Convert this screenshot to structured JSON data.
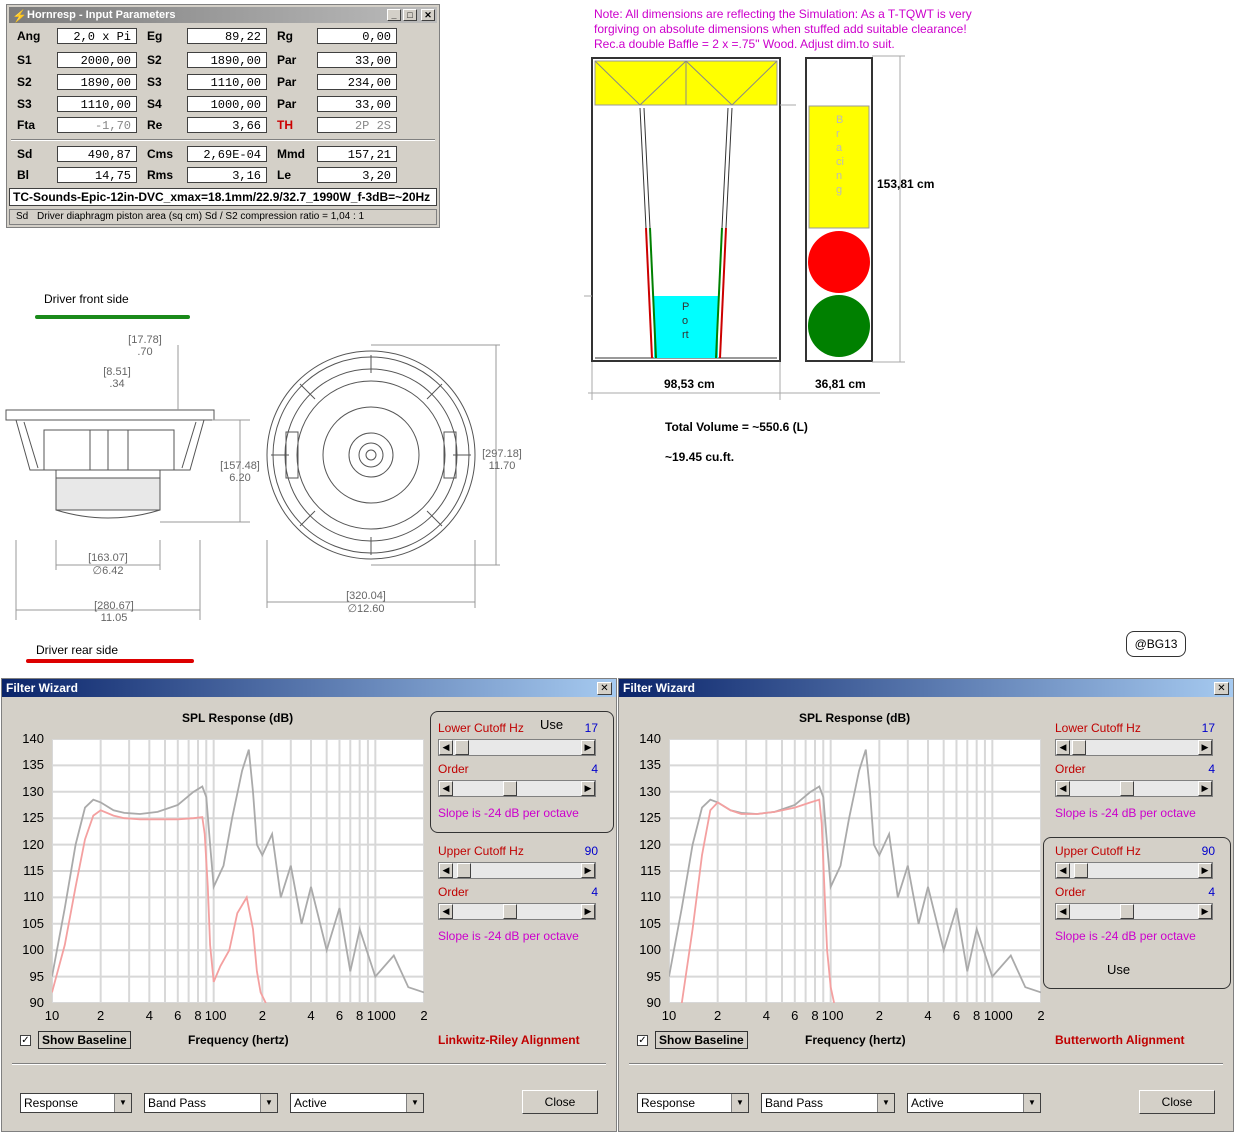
{
  "hornresp": {
    "title": "Hornresp - Input Parameters",
    "rows": [
      [
        {
          "l": "Ang",
          "v": "2,0 x Pi"
        },
        {
          "l": "Eg",
          "v": "89,22"
        },
        {
          "l": "Rg",
          "v": "0,00"
        }
      ],
      [
        {
          "l": "S1",
          "v": "2000,00"
        },
        {
          "l": "S2",
          "v": "1890,00"
        },
        {
          "l": "Par",
          "v": "33,00"
        }
      ],
      [
        {
          "l": "S2",
          "v": "1890,00"
        },
        {
          "l": "S3",
          "v": "1110,00"
        },
        {
          "l": "Par",
          "v": "234,00"
        }
      ],
      [
        {
          "l": "S3",
          "v": "1110,00"
        },
        {
          "l": "S4",
          "v": "1000,00"
        },
        {
          "l": "Par",
          "v": "33,00"
        }
      ],
      [
        {
          "l": "Fta",
          "v": "-1,70"
        },
        {
          "l": "Re",
          "v": "3,66"
        },
        {
          "l": "TH",
          "v": "2P 2S"
        }
      ],
      [
        {
          "l": "Sd",
          "v": "490,87"
        },
        {
          "l": "Cms",
          "v": "2,69E-04"
        },
        {
          "l": "Mmd",
          "v": "157,21"
        }
      ],
      [
        {
          "l": "Bl",
          "v": "14,75"
        },
        {
          "l": "Rms",
          "v": "3,16"
        },
        {
          "l": "Le",
          "v": "3,20"
        }
      ]
    ],
    "driver_name": "TC-Sounds-Epic-12in-DVC_xmax=18.1mm/22.9/32.7_1990W_f-3dB=~20Hz",
    "status_code": "Sd",
    "status_text": "Driver diaphragm piston area  (sq cm)   Sd / S2 compression ratio = 1,04 : 1"
  },
  "note": {
    "line1": "Note: All dimensions are reflecting the Simulation: As a T-TQWT is very",
    "line2": "forgiving on absolute dimensions when stuffed  add suitable clearance!",
    "line3": "Rec.a double Baffle = 2 x =.75\" Wood. Adjust dim.to suit."
  },
  "cabinet": {
    "port_label": "Port",
    "bracing_label": "Bracing",
    "height": "153,81 cm",
    "width": "98,53 cm",
    "depth": "36,81 cm",
    "volume": "Total Volume = ~550.6 (L)",
    "volume_cuft": "~19.45  cu.ft."
  },
  "driver": {
    "front_label": "Driver front side",
    "rear_label": "Driver rear side",
    "dims": {
      "d1a": "[17.78]",
      "d1b": ".70",
      "d2a": "[8.51]",
      "d2b": ".34",
      "d3a": "[157.48]",
      "d3b": "6.20",
      "d4a": "[163.07]",
      "d4b": "∅6.42",
      "d5a": "[280.67]",
      "d5b": "11.05",
      "d6a": "[297.18]",
      "d6b": "11.70",
      "d7a": "[320.04]",
      "d7b": "∅12.60"
    }
  },
  "signature": "@BG13",
  "wizards": [
    {
      "title": "Filter Wizard",
      "plot_title": "SPL Response (dB)",
      "y_ticks": [
        "140",
        "135",
        "130",
        "125",
        "120",
        "115",
        "110",
        "105",
        "100",
        "95",
        "90"
      ],
      "x_ticks": [
        "10",
        "2",
        "4",
        "6",
        "8",
        "100",
        "2",
        "4",
        "6",
        "8",
        "1000",
        "2"
      ],
      "x_label": "Frequency (hertz)",
      "baseline_label": "Show Baseline",
      "alignment": "Linkwitz-Riley Alignment",
      "lower_cutoff_label": "Lower Cutoff  Hz",
      "lower_cutoff_value": "17",
      "lower_use": "Use",
      "order_label": "Order",
      "lower_order_value": "4",
      "lower_slope": "Slope is -24 dB per octave",
      "upper_cutoff_label": "Upper Cutoff  Hz",
      "upper_cutoff_value": "90",
      "upper_order_value": "4",
      "upper_slope": "Slope is -24 dB per octave",
      "upper_use": "",
      "dd1": "Response",
      "dd2": "Band Pass",
      "dd3": "Active",
      "close": "Close"
    },
    {
      "title": "Filter Wizard",
      "plot_title": "SPL Response (dB)",
      "y_ticks": [
        "140",
        "135",
        "130",
        "125",
        "120",
        "115",
        "110",
        "105",
        "100",
        "95",
        "90"
      ],
      "x_ticks": [
        "10",
        "2",
        "4",
        "6",
        "8",
        "100",
        "2",
        "4",
        "6",
        "8",
        "1000",
        "2"
      ],
      "x_label": "Frequency (hertz)",
      "baseline_label": "Show Baseline",
      "alignment": "Butterworth Alignment",
      "lower_cutoff_label": "Lower Cutoff  Hz",
      "lower_cutoff_value": "17",
      "lower_use": "",
      "order_label": "Order",
      "lower_order_value": "4",
      "lower_slope": "Slope is -24 dB per octave",
      "upper_cutoff_label": "Upper Cutoff  Hz",
      "upper_cutoff_value": "90",
      "upper_order_value": "4",
      "upper_slope": "Slope is -24 dB per octave",
      "upper_use": "Use",
      "dd1": "Response",
      "dd2": "Band Pass",
      "dd3": "Active",
      "close": "Close"
    }
  ],
  "colors": {
    "filtered_curve": "#f4a0a0",
    "baseline_curve": "#aaaaaa",
    "yellow": "#ffff00",
    "port": "#00ffff",
    "red_circle": "#ff0000",
    "green_circle": "#008000"
  },
  "chart_data": [
    {
      "type": "line",
      "title": "SPL Response (dB)",
      "xlabel": "Frequency (hertz)",
      "ylabel": "",
      "xscale": "log",
      "xlim": [
        10,
        2000
      ],
      "ylim": [
        90,
        140
      ],
      "series": [
        {
          "x": [
            10,
            12,
            14,
            16,
            18,
            20,
            24,
            28,
            35,
            45,
            60,
            75,
            85,
            90,
            95,
            100,
            115,
            130,
            150,
            165,
            175,
            185,
            200,
            230,
            260,
            300,
            350,
            400,
            500,
            600,
            700,
            800,
            1000,
            1300,
            1600,
            2000
          ],
          "y": [
            95,
            108,
            120,
            127,
            128.5,
            128,
            126.5,
            126,
            125.8,
            126.2,
            127.5,
            130,
            131,
            129,
            120,
            112,
            116,
            125,
            134,
            138,
            130,
            120,
            118,
            122,
            110,
            116,
            105,
            112,
            100,
            108,
            96,
            104,
            95,
            99,
            93,
            92
          ]
        },
        {
          "x": [
            10,
            12,
            14,
            16,
            18,
            20,
            24,
            28,
            35,
            45,
            60,
            75,
            85,
            88,
            92,
            95,
            100,
            110,
            125,
            140,
            160,
            175,
            185,
            195,
            210
          ],
          "y": [
            92,
            101,
            112,
            121,
            125.5,
            126.5,
            125.5,
            125,
            124.8,
            124.8,
            124.8,
            125,
            125.2,
            122,
            112,
            101,
            94,
            97,
            100,
            107,
            110,
            104,
            96,
            92,
            90
          ]
        }
      ]
    },
    {
      "type": "line",
      "title": "SPL Response (dB)",
      "xlabel": "Frequency (hertz)",
      "ylabel": "",
      "xscale": "log",
      "xlim": [
        10,
        2000
      ],
      "ylim": [
        90,
        140
      ],
      "series": [
        {
          "x": [
            10,
            12,
            14,
            16,
            18,
            20,
            24,
            28,
            35,
            45,
            60,
            75,
            85,
            90,
            95,
            100,
            115,
            130,
            150,
            165,
            175,
            185,
            200,
            230,
            260,
            300,
            350,
            400,
            500,
            600,
            700,
            800,
            1000,
            1300,
            1600,
            2000
          ],
          "y": [
            95,
            108,
            120,
            127,
            128.5,
            128,
            126.5,
            126,
            125.8,
            126.2,
            127.5,
            130,
            131,
            129,
            120,
            112,
            116,
            125,
            134,
            138,
            130,
            120,
            118,
            122,
            110,
            116,
            105,
            112,
            100,
            108,
            96,
            104,
            95,
            99,
            93,
            92
          ]
        },
        {
          "x": [
            12,
            14,
            16,
            18,
            20,
            24,
            28,
            35,
            45,
            60,
            75,
            85,
            88,
            92,
            95,
            100,
            105
          ],
          "y": [
            90,
            104,
            118,
            126.5,
            128,
            126.5,
            125.8,
            125.8,
            126.2,
            127,
            128,
            128.5,
            124,
            110,
            100,
            93,
            90
          ]
        }
      ]
    }
  ]
}
